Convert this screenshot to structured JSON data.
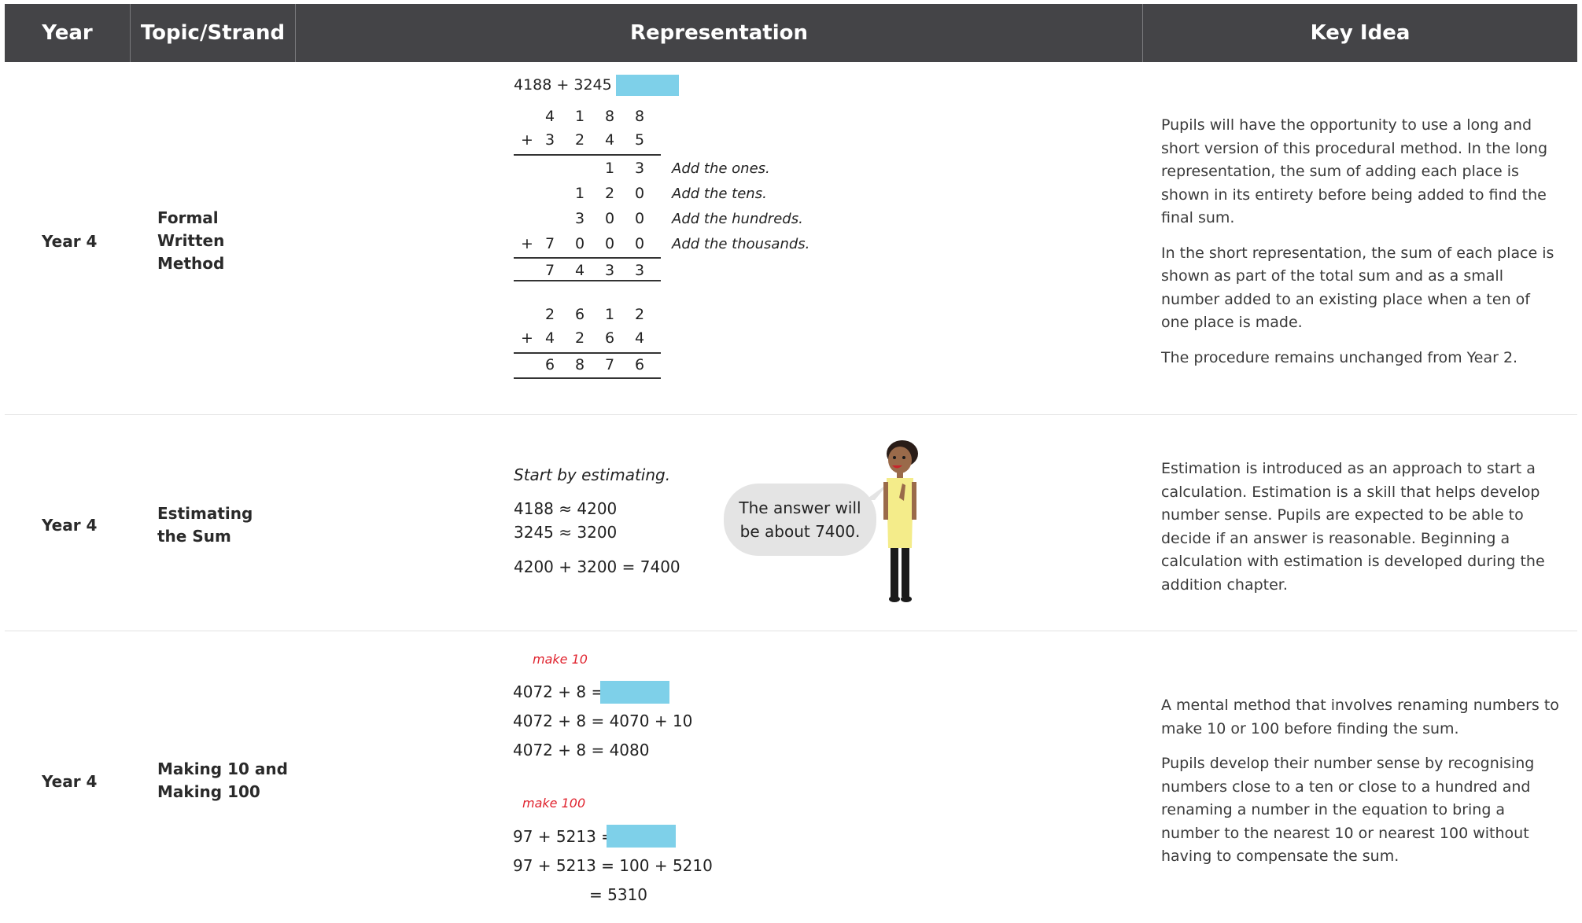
{
  "header": {
    "year": "Year",
    "topic": "Topic/Strand",
    "representation": "Representation",
    "key_idea": "Key Idea"
  },
  "rows": [
    {
      "year": "Year 4",
      "topic": [
        "Formal",
        "Written",
        "Method"
      ],
      "rep": {
        "equation": "4188 + 3245 =",
        "long": {
          "top": [
            "4",
            "1",
            "8",
            "8"
          ],
          "addend_sign": "+",
          "addend": [
            "3",
            "2",
            "4",
            "5"
          ],
          "partials": [
            {
              "sign": "",
              "digits": [
                "",
                "",
                "1",
                "3"
              ],
              "note": "Add the ones."
            },
            {
              "sign": "",
              "digits": [
                "",
                "1",
                "2",
                "0"
              ],
              "note": "Add the tens."
            },
            {
              "sign": "",
              "digits": [
                "",
                "3",
                "0",
                "0"
              ],
              "note": "Add the hundreds."
            },
            {
              "sign": "+",
              "digits": [
                "7",
                "0",
                "0",
                "0"
              ],
              "note": "Add the thousands."
            }
          ],
          "total": [
            "7",
            "4",
            "3",
            "3"
          ]
        },
        "short": {
          "top": [
            "2",
            "6",
            "1",
            "2"
          ],
          "addend_sign": "+",
          "addend": [
            "4",
            "2",
            "6",
            "4"
          ],
          "total": [
            "6",
            "8",
            "7",
            "6"
          ]
        }
      },
      "key_idea": [
        "Pupils will have the opportunity to use a long and short version of this procedural method. In the long representation, the sum of adding each place is shown in its entirety before being added to find the final sum.",
        "In the short representation, the sum of each place is shown as part of the total sum and as a small number added to an existing place when a ten of one place is made.",
        "The procedure remains unchanged from Year 2."
      ]
    },
    {
      "year": "Year 4",
      "topic": [
        "Estimating",
        "the Sum"
      ],
      "rep": {
        "intro": "Start by estimating.",
        "line1": "4188 ≈ 4200",
        "line2": "3245 ≈ 3200",
        "line3": "4200 + 3200 = 7400",
        "bubble": [
          "The answer will",
          "be about 7400."
        ]
      },
      "key_idea": [
        "Estimation is introduced as an approach to start a calculation. Estimation is a skill that helps develop number sense. Pupils are expected to be able to decide if an answer is reasonable. Beginning a calculation with estimation is developed during the addition chapter."
      ]
    },
    {
      "year": "Year 4",
      "topic": [
        "Making 10 and",
        "Making 100"
      ],
      "rep": {
        "label1": "make 10",
        "eq1a": "4072 + 8 =",
        "eq1b": "4072 + 8 = 4070 + 10",
        "eq1c": "4072 + 8 = 4080",
        "label2": "make 100",
        "eq2a": "97 + 5213 =",
        "eq2b": "97 + 5213 = 100 + 5210",
        "eq2c": "= 5310"
      },
      "key_idea": [
        "A mental method that involves renaming numbers to make 10 or 100 before finding the sum.",
        "Pupils develop their number sense by recognising numbers close to a ten or close to a hundred and renaming a number in the equation to bring a number to the nearest 10 or nearest 100 without having to compensate the sum."
      ]
    }
  ],
  "colors": {
    "header_bg": "#444447",
    "answer_box": "#7ed0e9",
    "red_label": "#e0242f",
    "bubble": "#e4e4e4"
  }
}
